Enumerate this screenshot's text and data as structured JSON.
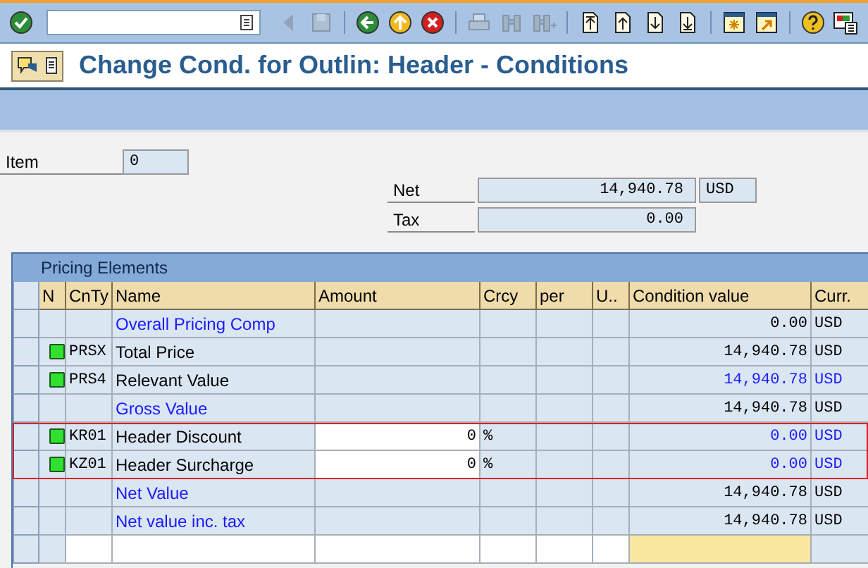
{
  "toolbar": [
    {
      "kind": "enter",
      "disabled": false
    },
    {
      "kind": "command"
    },
    {
      "kind": "triangle-back",
      "disabled": true
    },
    {
      "kind": "save",
      "disabled": true
    },
    {
      "kind": "sep"
    },
    {
      "kind": "back",
      "disabled": false
    },
    {
      "kind": "exit",
      "disabled": false
    },
    {
      "kind": "cancel",
      "disabled": false
    },
    {
      "kind": "sep"
    },
    {
      "kind": "print",
      "disabled": true
    },
    {
      "kind": "find",
      "disabled": true
    },
    {
      "kind": "find-next",
      "disabled": true
    },
    {
      "kind": "sep"
    },
    {
      "kind": "first-page",
      "disabled": false
    },
    {
      "kind": "prev-page",
      "disabled": false
    },
    {
      "kind": "next-page",
      "disabled": false
    },
    {
      "kind": "last-page",
      "disabled": false
    },
    {
      "kind": "sep"
    },
    {
      "kind": "new-session",
      "disabled": false
    },
    {
      "kind": "shortcut",
      "disabled": false
    },
    {
      "kind": "sep"
    },
    {
      "kind": "help",
      "disabled": false
    },
    {
      "kind": "layout",
      "disabled": false
    }
  ],
  "window": {
    "title": "Change Cond. for Outlin: Header - Conditions"
  },
  "item": {
    "label": "Item",
    "value": "0"
  },
  "totals": [
    {
      "label": "Net",
      "value": "14,940.78",
      "currency": "USD"
    },
    {
      "label": "Tax",
      "value": "0.00"
    }
  ],
  "pricing": {
    "title": "Pricing Elements",
    "columns": [
      "N",
      "CnTy",
      "Name",
      "Amount",
      "Crcy",
      "per",
      "U..",
      "Condition value",
      "Curr."
    ],
    "rows": [
      {
        "kind": "subtotal",
        "status": false,
        "cnty": "",
        "name": "Overall Pricing Comp",
        "amount": "",
        "crcy": "",
        "value": "0.00",
        "value_blue": false,
        "curr": "USD",
        "highlighted": false
      },
      {
        "kind": "condition",
        "status": true,
        "cnty": "PRSX",
        "name": "Total Price",
        "amount": "",
        "crcy": "",
        "value": "14,940.78",
        "value_blue": false,
        "curr": "USD",
        "highlighted": false
      },
      {
        "kind": "condition",
        "status": true,
        "cnty": "PRS4",
        "name": "Relevant Value",
        "amount": "",
        "crcy": "",
        "value": "14,940.78",
        "value_blue": true,
        "curr": "USD",
        "highlighted": false
      },
      {
        "kind": "subtotal",
        "status": false,
        "cnty": "",
        "name": "Gross Value",
        "amount": "",
        "crcy": "",
        "value": "14,940.78",
        "value_blue": false,
        "curr": "USD",
        "highlighted": false
      },
      {
        "kind": "editable",
        "status": true,
        "cnty": "KR01",
        "name": "Header Discount",
        "amount": "0",
        "crcy": "%",
        "value": "0.00",
        "value_blue": true,
        "curr": "USD",
        "highlighted": true
      },
      {
        "kind": "editable",
        "status": true,
        "cnty": "KZ01",
        "name": "Header Surcharge",
        "amount": "0",
        "crcy": "%",
        "value": "0.00",
        "value_blue": true,
        "curr": "USD",
        "highlighted": true
      },
      {
        "kind": "subtotal",
        "status": false,
        "cnty": "",
        "name": "Net Value",
        "amount": "",
        "crcy": "",
        "value": "14,940.78",
        "value_blue": false,
        "curr": "USD",
        "highlighted": false
      },
      {
        "kind": "subtotal",
        "status": false,
        "cnty": "",
        "name": "Net value inc. tax",
        "amount": "",
        "crcy": "",
        "value": "14,940.78",
        "value_blue": false,
        "curr": "USD",
        "highlighted": false
      },
      {
        "kind": "entry",
        "highlighted": false
      }
    ]
  }
}
